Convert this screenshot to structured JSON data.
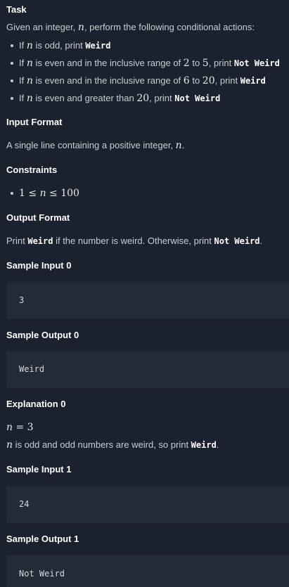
{
  "task": {
    "heading": "Task",
    "intro_pre": "Given an integer, ",
    "intro_var": "n",
    "intro_post": ", perform the following conditional actions:",
    "conditions": [
      {
        "pre": "If ",
        "var": "n",
        "mid": " is odd, print ",
        "code": "Weird"
      },
      {
        "pre": "If ",
        "var": "n",
        "mid": " is even and in the inclusive range of ",
        "a": "2",
        "to": " to ",
        "b": "5",
        "print": ", print ",
        "code": "Not Weird"
      },
      {
        "pre": "If ",
        "var": "n",
        "mid": " is even and in the inclusive range of ",
        "a": "6",
        "to": " to ",
        "b": "20",
        "print": ", print ",
        "code": "Weird"
      },
      {
        "pre": "If ",
        "var": "n",
        "mid": " is even and greater than ",
        "a": "20",
        "print": ", print ",
        "code": "Not Weird"
      }
    ]
  },
  "input_format": {
    "heading": "Input Format",
    "text_pre": "A single line containing a positive integer, ",
    "var": "n",
    "text_post": "."
  },
  "constraints": {
    "heading": "Constraints",
    "items": [
      {
        "lo": "1",
        "le1": " ≤ ",
        "var": "n",
        "le2": " ≤ ",
        "hi": "100"
      }
    ]
  },
  "output_format": {
    "heading": "Output Format",
    "pre": "Print ",
    "code1": "Weird",
    "mid": " if the number is weird. Otherwise, print ",
    "code2": "Not Weird",
    "post": "."
  },
  "samples": [
    {
      "input_heading": "Sample Input 0",
      "input": "3",
      "output_heading": "Sample Output 0",
      "output": "Weird"
    },
    {
      "input_heading": "Sample Input 1",
      "input": "24",
      "output_heading": "Sample Output 1",
      "output": "Not Weird"
    }
  ],
  "explanation": {
    "heading": "Explanation 0",
    "eq_var": "n",
    "eq_sign": " = ",
    "eq_val": "3",
    "line_var": "n",
    "line_text": " is odd and odd numbers are weird, so print ",
    "line_code": "Weird",
    "line_post": "."
  },
  "colors": {
    "background": "#1b222d",
    "code_block": "#232b37",
    "heading": "#ffffff",
    "text": "#c8ccd3"
  }
}
